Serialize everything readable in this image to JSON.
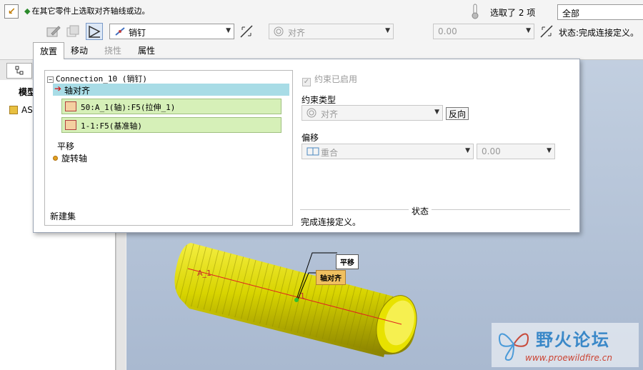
{
  "dashboard": {
    "prompt": "在其它零件上选取对齐轴线或边。",
    "selection_count": "选取了 2 项",
    "selection_filter": "全部",
    "connection_type": "销钉",
    "constraint_type": "对齐",
    "offset_value": "0.00",
    "status": "状态:完成连接定义。"
  },
  "tabs": [
    "放置",
    "移动",
    "挠性",
    "属性"
  ],
  "left_panel": {
    "title": "模型",
    "item": "AS"
  },
  "placement": {
    "tree": {
      "root": "Connection_10 (销钉)",
      "axial_label": "轴对齐",
      "ref1": "50:A_1(轴):F5(拉伸_1)",
      "ref2": "1-1:F5(基准轴)",
      "translation": "平移",
      "rotation_axis": "旋转轴"
    },
    "new_set": "新建集",
    "constraint_enabled": "约束已启用",
    "constraint_type_label": "约束类型",
    "constraint_type_value": "对齐",
    "flip_button": "反向",
    "offset_label": "偏移",
    "offset_type": "重合",
    "offset_value": "0.00",
    "status_title": "状态",
    "status_message": "完成连接定义。"
  },
  "viewport": {
    "tag_translation": "平移",
    "tag_axial": "轴对齐",
    "datum_label_a1": "A_1",
    "datum_label_axis": "1"
  },
  "watermark": {
    "title": "野火论坛",
    "url": "www.proewildfire.cn"
  },
  "colors": {
    "model_yellow": "#d8d400",
    "highlight_row": "#a8dce6",
    "reference_row": "#d6f0b8",
    "viewport_bg": "#b4c2d8"
  }
}
